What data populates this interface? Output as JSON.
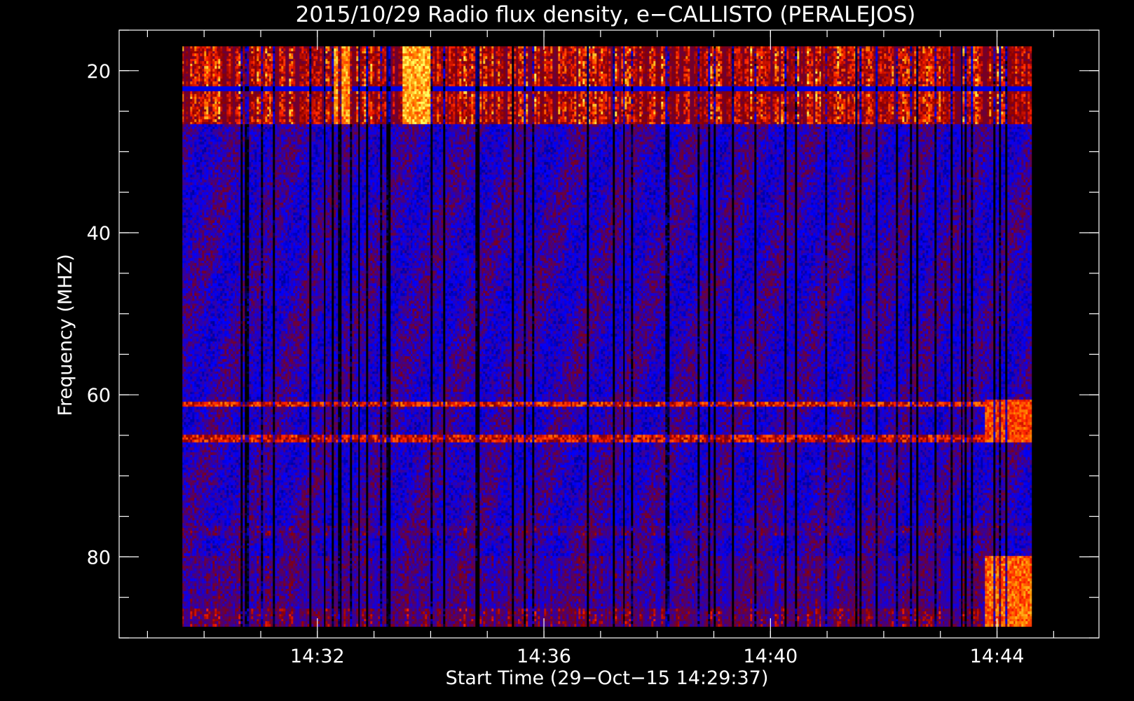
{
  "chart_data": {
    "type": "heatmap",
    "title": "2015/10/29  Radio flux density, e−CALLISTO (PERALEJOS)",
    "xlabel": "Start Time (29−Oct−15 14:29:37)",
    "ylabel": "Frequency (MHZ)",
    "x_unit": "UT time (minutes after 14:00)",
    "xlim": [
      28.5,
      45.8
    ],
    "ylim": [
      90,
      15
    ],
    "data_extent_x": [
      29.617,
      44.617
    ],
    "data_extent_y": [
      17,
      88.6
    ],
    "x_ticks": [
      {
        "value": 32,
        "label": "14:32"
      },
      {
        "value": 36,
        "label": "14:36"
      },
      {
        "value": 40,
        "label": "14:40"
      },
      {
        "value": 44,
        "label": "14:44"
      }
    ],
    "x_minor_step": 1,
    "y_ticks": [
      {
        "value": 20,
        "label": "20"
      },
      {
        "value": 40,
        "label": "40"
      },
      {
        "value": 60,
        "label": "60"
      },
      {
        "value": 80,
        "label": "80"
      }
    ],
    "y_minor_step": 5,
    "grid": false,
    "colormap": [
      "#000000",
      "#0000ff",
      "#8b0000",
      "#ff2000",
      "#ff9000",
      "#ffff60"
    ],
    "background_level": 0.3,
    "features": [
      {
        "kind": "frequency_band",
        "freq_range": [
          17,
          26.5
        ],
        "intensity": 0.78
      },
      {
        "kind": "frequency_line",
        "freq": 22.3,
        "intensity": 0.2
      },
      {
        "kind": "frequency_line",
        "freq": 61.2,
        "intensity": 0.75
      },
      {
        "kind": "frequency_line",
        "freq": 65.3,
        "intensity": 0.72
      },
      {
        "kind": "frequency_band",
        "freq_range": [
          86.5,
          88.6
        ],
        "intensity": 0.55
      },
      {
        "kind": "frequency_band",
        "freq_range": [
          76,
          77.5
        ],
        "intensity": 0.45
      },
      {
        "kind": "frequency_band",
        "freq_range": [
          80,
          86.5
        ],
        "intensity": 0.42
      },
      {
        "kind": "burst_region",
        "time_range": [
          33.5,
          34.0
        ],
        "freq_range": [
          17,
          26.5
        ],
        "intensity": 0.98
      },
      {
        "kind": "burst_region",
        "time_range": [
          32.3,
          32.6
        ],
        "freq_range": [
          17,
          26.5
        ],
        "intensity": 0.93
      },
      {
        "kind": "burst_region",
        "time_range": [
          43.8,
          44.6
        ],
        "freq_range": [
          80,
          88.6
        ],
        "intensity": 0.85
      },
      {
        "kind": "burst_region",
        "time_range": [
          43.8,
          44.6
        ],
        "freq_range": [
          60.5,
          66
        ],
        "intensity": 0.8
      }
    ]
  }
}
